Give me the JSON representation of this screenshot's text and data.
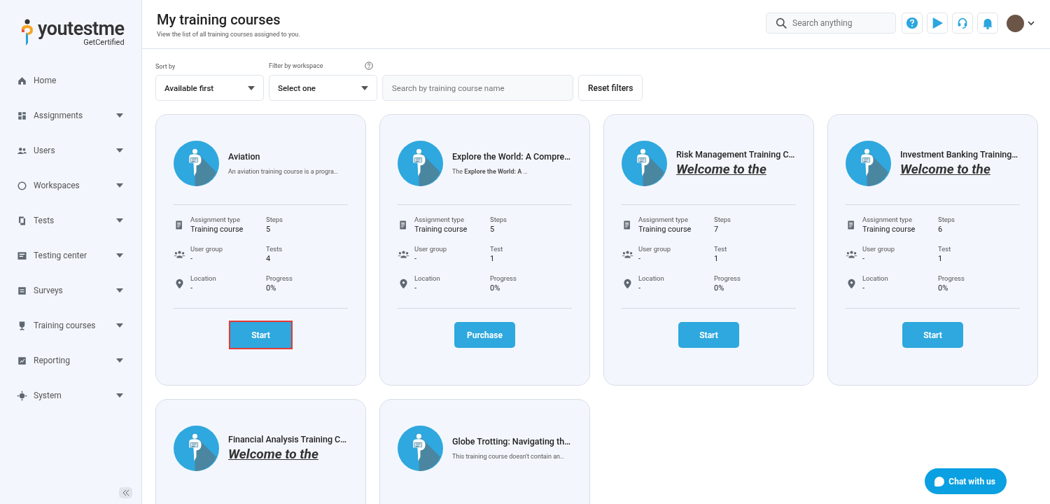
{
  "logo": {
    "name": "youtestme",
    "tagline": "GetCertified"
  },
  "sidebar": {
    "items": [
      {
        "label": "Home",
        "has_submenu": false
      },
      {
        "label": "Assignments",
        "has_submenu": true
      },
      {
        "label": "Users",
        "has_submenu": true
      },
      {
        "label": "Workspaces",
        "has_submenu": true
      },
      {
        "label": "Tests",
        "has_submenu": true
      },
      {
        "label": "Testing center",
        "has_submenu": true
      },
      {
        "label": "Surveys",
        "has_submenu": true
      },
      {
        "label": "Training courses",
        "has_submenu": true
      },
      {
        "label": "Reporting",
        "has_submenu": true
      },
      {
        "label": "System",
        "has_submenu": true
      }
    ]
  },
  "header": {
    "title": "My training courses",
    "subtitle": "View the list of all training courses assigned to you.",
    "search": {
      "placeholder": "Search anything"
    }
  },
  "filters": {
    "sort": {
      "label": "Sort by",
      "value": "Available first"
    },
    "workspace": {
      "label": "Filter by workspace",
      "value": "Select one"
    },
    "search": {
      "placeholder": "Search by training course name"
    },
    "reset": "Reset filters"
  },
  "courses": [
    {
      "title": "Aviation",
      "description": {
        "kind": "plain",
        "text": "An aviation training course is a progra…"
      },
      "details": [
        {
          "label": "Assignment type",
          "value": "Training course"
        },
        {
          "label": "Steps",
          "value": "5"
        },
        {
          "label": "User group",
          "value": "-"
        },
        {
          "label": "Tests",
          "value": "4"
        },
        {
          "label": "Location",
          "value": "-"
        },
        {
          "label": "Progress",
          "value": "0%"
        }
      ],
      "button": {
        "label": "Start",
        "highlighted": true
      }
    },
    {
      "title": "Explore the World: A Compre…",
      "description": {
        "kind": "plain",
        "text": "The **Explore the World: A** …"
      },
      "details": [
        {
          "label": "Assignment type",
          "value": "Training course"
        },
        {
          "label": "Steps",
          "value": "5"
        },
        {
          "label": "User group",
          "value": "-"
        },
        {
          "label": "Test",
          "value": "1"
        },
        {
          "label": "Location",
          "value": "-"
        },
        {
          "label": "Progress",
          "value": "0%"
        }
      ],
      "button": {
        "label": "Purchase",
        "highlighted": false
      }
    },
    {
      "title": "Risk Management Training C…",
      "description": {
        "kind": "headline",
        "text": "Welcome to the"
      },
      "details": [
        {
          "label": "Assignment type",
          "value": "Training course"
        },
        {
          "label": "Steps",
          "value": "7"
        },
        {
          "label": "User group",
          "value": "-"
        },
        {
          "label": "Test",
          "value": "1"
        },
        {
          "label": "Location",
          "value": "-"
        },
        {
          "label": "Progress",
          "value": "0%"
        }
      ],
      "button": {
        "label": "Start",
        "highlighted": false
      }
    },
    {
      "title": "Investment Banking Training…",
      "description": {
        "kind": "headline",
        "text": "Welcome to the"
      },
      "details": [
        {
          "label": "Assignment type",
          "value": "Training course"
        },
        {
          "label": "Steps",
          "value": "6"
        },
        {
          "label": "User group",
          "value": "-"
        },
        {
          "label": "Test",
          "value": "1"
        },
        {
          "label": "Location",
          "value": "-"
        },
        {
          "label": "Progress",
          "value": "0%"
        }
      ],
      "button": {
        "label": "Start",
        "highlighted": false
      }
    },
    {
      "title": "Financial Analysis Training C…",
      "description": {
        "kind": "headline",
        "text": "Welcome to the"
      }
    },
    {
      "title": "Globe Trotting: Navigating th…",
      "description": {
        "kind": "plain",
        "text": "This training course doesn't contain an…"
      }
    }
  ],
  "chat": {
    "label": "Chat with us"
  }
}
